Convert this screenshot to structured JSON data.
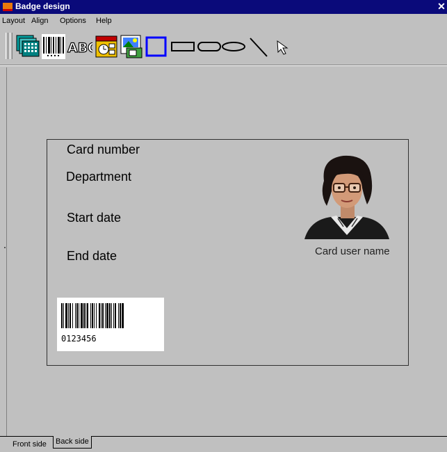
{
  "window": {
    "title": "Badge design",
    "close_glyph": "✕"
  },
  "menu": {
    "items": [
      "Layout",
      "Align",
      "Options",
      "Help"
    ]
  },
  "toolbar": {
    "tools": [
      {
        "icon": "badge-template-icon"
      },
      {
        "icon": "barcode-tool-icon"
      },
      {
        "icon": "text-tool-icon",
        "label": "ABC"
      },
      {
        "icon": "date-field-tool-icon"
      },
      {
        "icon": "photo-tool-icon"
      },
      {
        "icon": "rectangle-tool-icon"
      },
      {
        "icon": "rounded-rectangle-tool-icon"
      },
      {
        "icon": "rounded-box-tool-icon"
      },
      {
        "icon": "ellipse-tool-icon"
      },
      {
        "icon": "line-tool-icon"
      },
      {
        "icon": "pointer-tool-icon"
      }
    ]
  },
  "badge": {
    "fields": {
      "card_number": "Card number",
      "department": "Department",
      "start_date": "Start date",
      "end_date": "End date",
      "card_user_name": "Card user name"
    },
    "barcode_value": "0123456"
  },
  "tabs": {
    "front": "Front side",
    "back": "Back side",
    "active": "front"
  },
  "colors": {
    "titlebar": "#0a0a7a",
    "selected_tool_border": "#0000ff",
    "background": "#c0c0c0"
  }
}
